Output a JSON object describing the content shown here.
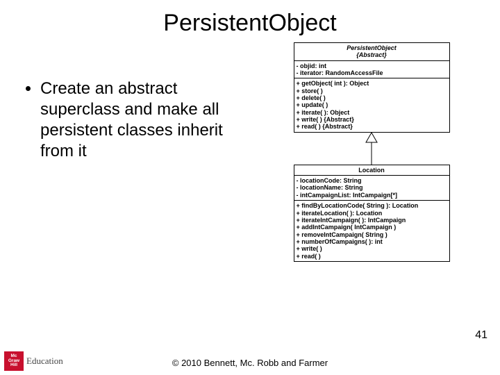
{
  "title": "PersistentObject",
  "bullet": "Create an abstract superclass and make all persistent classes inherit from it",
  "uml_top": {
    "name": "PersistentObject",
    "stereo": "{Abstract}",
    "attrs": [
      "- objid: int",
      "- iterator: RandomAccessFile"
    ],
    "ops": [
      "+ getObject( int ): Object",
      "+ store( )",
      "+ delete( )",
      "+ update( )",
      "+ iterate( ): Object",
      "+ write( ) {Abstract}",
      "+ read( ) {Abstract}"
    ]
  },
  "uml_bottom": {
    "name": "Location",
    "attrs": [
      "- locationCode: String",
      "- locationName: String",
      "- intCampaignList: IntCampaign[*]"
    ],
    "ops": [
      "+ findByLocationCode( String ): Location",
      "+ iterateLocation( ): Location",
      "+ iterateIntCampaign( ): IntCampaign",
      "+ addIntCampaign( IntCampaign )",
      "+ removeIntCampaign( String )",
      "+ numberOfCampaigns( ): int",
      "+ write( )",
      "+ read( )"
    ]
  },
  "footer_text": "© 2010 Bennett, Mc. Robb and Farmer",
  "page_number": "41",
  "logo": {
    "l1": "Mc",
    "l2": "Graw",
    "l3": "Hill",
    "text": "Education"
  }
}
